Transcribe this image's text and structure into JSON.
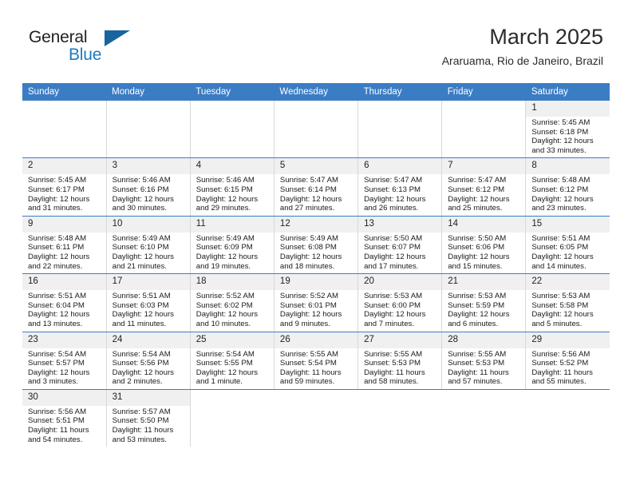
{
  "brand": {
    "name_part1": "General",
    "name_part2": "Blue",
    "colors": {
      "dark": "#231f20",
      "blue": "#1c7ac0",
      "triangle": "#16659f"
    }
  },
  "header": {
    "title": "March 2025",
    "location": "Araruama, Rio de Janeiro, Brazil"
  },
  "theme": {
    "header_band": "#3b7dc4",
    "date_band": "#f0f0f0",
    "row_rule": "#3b7dc4",
    "column_rule": "#d8d8d8"
  },
  "calendar": {
    "weekdays": [
      "Sunday",
      "Monday",
      "Tuesday",
      "Wednesday",
      "Thursday",
      "Friday",
      "Saturday"
    ],
    "weeks": [
      [
        {
          "day": "",
          "lines": []
        },
        {
          "day": "",
          "lines": []
        },
        {
          "day": "",
          "lines": []
        },
        {
          "day": "",
          "lines": []
        },
        {
          "day": "",
          "lines": []
        },
        {
          "day": "",
          "lines": []
        },
        {
          "day": "1",
          "lines": [
            "Sunrise: 5:45 AM",
            "Sunset: 6:18 PM",
            "Daylight: 12 hours",
            "and 33 minutes."
          ]
        }
      ],
      [
        {
          "day": "2",
          "lines": [
            "Sunrise: 5:45 AM",
            "Sunset: 6:17 PM",
            "Daylight: 12 hours",
            "and 31 minutes."
          ]
        },
        {
          "day": "3",
          "lines": [
            "Sunrise: 5:46 AM",
            "Sunset: 6:16 PM",
            "Daylight: 12 hours",
            "and 30 minutes."
          ]
        },
        {
          "day": "4",
          "lines": [
            "Sunrise: 5:46 AM",
            "Sunset: 6:15 PM",
            "Daylight: 12 hours",
            "and 29 minutes."
          ]
        },
        {
          "day": "5",
          "lines": [
            "Sunrise: 5:47 AM",
            "Sunset: 6:14 PM",
            "Daylight: 12 hours",
            "and 27 minutes."
          ]
        },
        {
          "day": "6",
          "lines": [
            "Sunrise: 5:47 AM",
            "Sunset: 6:13 PM",
            "Daylight: 12 hours",
            "and 26 minutes."
          ]
        },
        {
          "day": "7",
          "lines": [
            "Sunrise: 5:47 AM",
            "Sunset: 6:12 PM",
            "Daylight: 12 hours",
            "and 25 minutes."
          ]
        },
        {
          "day": "8",
          "lines": [
            "Sunrise: 5:48 AM",
            "Sunset: 6:12 PM",
            "Daylight: 12 hours",
            "and 23 minutes."
          ]
        }
      ],
      [
        {
          "day": "9",
          "lines": [
            "Sunrise: 5:48 AM",
            "Sunset: 6:11 PM",
            "Daylight: 12 hours",
            "and 22 minutes."
          ]
        },
        {
          "day": "10",
          "lines": [
            "Sunrise: 5:49 AM",
            "Sunset: 6:10 PM",
            "Daylight: 12 hours",
            "and 21 minutes."
          ]
        },
        {
          "day": "11",
          "lines": [
            "Sunrise: 5:49 AM",
            "Sunset: 6:09 PM",
            "Daylight: 12 hours",
            "and 19 minutes."
          ]
        },
        {
          "day": "12",
          "lines": [
            "Sunrise: 5:49 AM",
            "Sunset: 6:08 PM",
            "Daylight: 12 hours",
            "and 18 minutes."
          ]
        },
        {
          "day": "13",
          "lines": [
            "Sunrise: 5:50 AM",
            "Sunset: 6:07 PM",
            "Daylight: 12 hours",
            "and 17 minutes."
          ]
        },
        {
          "day": "14",
          "lines": [
            "Sunrise: 5:50 AM",
            "Sunset: 6:06 PM",
            "Daylight: 12 hours",
            "and 15 minutes."
          ]
        },
        {
          "day": "15",
          "lines": [
            "Sunrise: 5:51 AM",
            "Sunset: 6:05 PM",
            "Daylight: 12 hours",
            "and 14 minutes."
          ]
        }
      ],
      [
        {
          "day": "16",
          "lines": [
            "Sunrise: 5:51 AM",
            "Sunset: 6:04 PM",
            "Daylight: 12 hours",
            "and 13 minutes."
          ]
        },
        {
          "day": "17",
          "lines": [
            "Sunrise: 5:51 AM",
            "Sunset: 6:03 PM",
            "Daylight: 12 hours",
            "and 11 minutes."
          ]
        },
        {
          "day": "18",
          "lines": [
            "Sunrise: 5:52 AM",
            "Sunset: 6:02 PM",
            "Daylight: 12 hours",
            "and 10 minutes."
          ]
        },
        {
          "day": "19",
          "lines": [
            "Sunrise: 5:52 AM",
            "Sunset: 6:01 PM",
            "Daylight: 12 hours",
            "and 9 minutes."
          ]
        },
        {
          "day": "20",
          "lines": [
            "Sunrise: 5:53 AM",
            "Sunset: 6:00 PM",
            "Daylight: 12 hours",
            "and 7 minutes."
          ]
        },
        {
          "day": "21",
          "lines": [
            "Sunrise: 5:53 AM",
            "Sunset: 5:59 PM",
            "Daylight: 12 hours",
            "and 6 minutes."
          ]
        },
        {
          "day": "22",
          "lines": [
            "Sunrise: 5:53 AM",
            "Sunset: 5:58 PM",
            "Daylight: 12 hours",
            "and 5 minutes."
          ]
        }
      ],
      [
        {
          "day": "23",
          "lines": [
            "Sunrise: 5:54 AM",
            "Sunset: 5:57 PM",
            "Daylight: 12 hours",
            "and 3 minutes."
          ]
        },
        {
          "day": "24",
          "lines": [
            "Sunrise: 5:54 AM",
            "Sunset: 5:56 PM",
            "Daylight: 12 hours",
            "and 2 minutes."
          ]
        },
        {
          "day": "25",
          "lines": [
            "Sunrise: 5:54 AM",
            "Sunset: 5:55 PM",
            "Daylight: 12 hours",
            "and 1 minute."
          ]
        },
        {
          "day": "26",
          "lines": [
            "Sunrise: 5:55 AM",
            "Sunset: 5:54 PM",
            "Daylight: 11 hours",
            "and 59 minutes."
          ]
        },
        {
          "day": "27",
          "lines": [
            "Sunrise: 5:55 AM",
            "Sunset: 5:53 PM",
            "Daylight: 11 hours",
            "and 58 minutes."
          ]
        },
        {
          "day": "28",
          "lines": [
            "Sunrise: 5:55 AM",
            "Sunset: 5:53 PM",
            "Daylight: 11 hours",
            "and 57 minutes."
          ]
        },
        {
          "day": "29",
          "lines": [
            "Sunrise: 5:56 AM",
            "Sunset: 5:52 PM",
            "Daylight: 11 hours",
            "and 55 minutes."
          ]
        }
      ],
      [
        {
          "day": "30",
          "lines": [
            "Sunrise: 5:56 AM",
            "Sunset: 5:51 PM",
            "Daylight: 11 hours",
            "and 54 minutes."
          ]
        },
        {
          "day": "31",
          "lines": [
            "Sunrise: 5:57 AM",
            "Sunset: 5:50 PM",
            "Daylight: 11 hours",
            "and 53 minutes."
          ]
        },
        {
          "day": "",
          "lines": []
        },
        {
          "day": "",
          "lines": []
        },
        {
          "day": "",
          "lines": []
        },
        {
          "day": "",
          "lines": []
        },
        {
          "day": "",
          "lines": []
        }
      ]
    ]
  }
}
